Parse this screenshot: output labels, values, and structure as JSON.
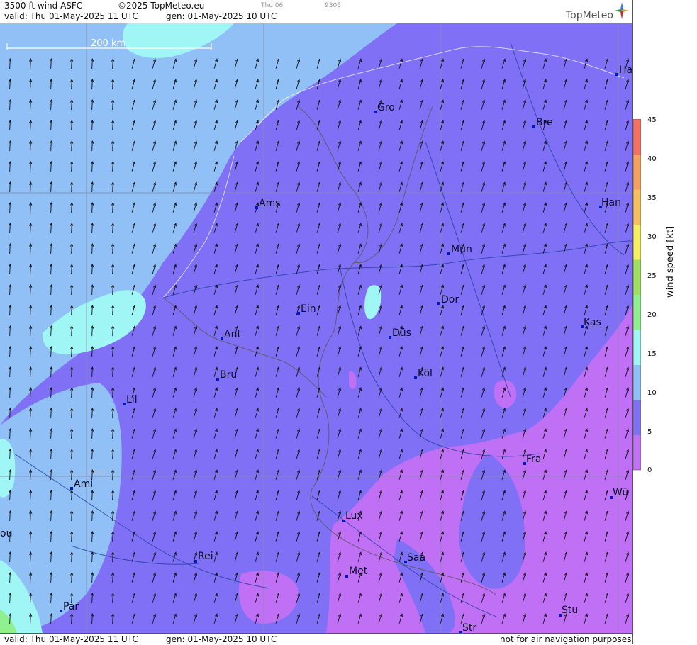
{
  "header": {
    "product": "3500 ft wind ASFC",
    "copyright": "©2025 TopMeteo.eu",
    "faint1": "Thu 06",
    "faint2": "9306",
    "valid": "valid:  Thu  01-May-2025  11 UTC",
    "gen": "gen: 01-May-2025 10 UTC",
    "logo": "TopMeteo"
  },
  "footer": {
    "valid": "valid:  Thu  01-May-2025  11 UTC",
    "gen": "gen: 01-May-2025 10 UTC",
    "disclaimer": "not for air navigation purposes"
  },
  "scale_label": "200 km",
  "lat_label": "N50",
  "cities": [
    {
      "name": "Gro"
    },
    {
      "name": "Bre"
    },
    {
      "name": "Ha"
    },
    {
      "name": "Ams"
    },
    {
      "name": "Han"
    },
    {
      "name": "Mün"
    },
    {
      "name": "Ein"
    },
    {
      "name": "Dor"
    },
    {
      "name": "Ant"
    },
    {
      "name": "Düs"
    },
    {
      "name": "Kas"
    },
    {
      "name": "Bru"
    },
    {
      "name": "Köl"
    },
    {
      "name": "Lil"
    },
    {
      "name": "Fra"
    },
    {
      "name": "Ami"
    },
    {
      "name": "Wü"
    },
    {
      "name": "Lux"
    },
    {
      "name": "ou"
    },
    {
      "name": "Rei"
    },
    {
      "name": "Saa"
    },
    {
      "name": "Met"
    },
    {
      "name": "Par"
    },
    {
      "name": "Stu"
    },
    {
      "name": "Str"
    }
  ],
  "colorbar": {
    "title": "wind  speed  [kt]",
    "ticks": [
      "45",
      "40",
      "35",
      "30",
      "25",
      "20",
      "15",
      "10",
      "5",
      "0"
    ],
    "colors": [
      "#c070f5",
      "#8070f5",
      "#90c0f5",
      "#a0f5f5",
      "#90f090",
      "#a0e060",
      "#f5f060",
      "#f5c060",
      "#f5a060",
      "#f57060"
    ]
  },
  "legend_colors": {
    "violet": "#c070f5",
    "blue_purple": "#8070f5",
    "light_blue": "#90c0f5",
    "cyan": "#a0f5f5",
    "green": "#90f090"
  }
}
